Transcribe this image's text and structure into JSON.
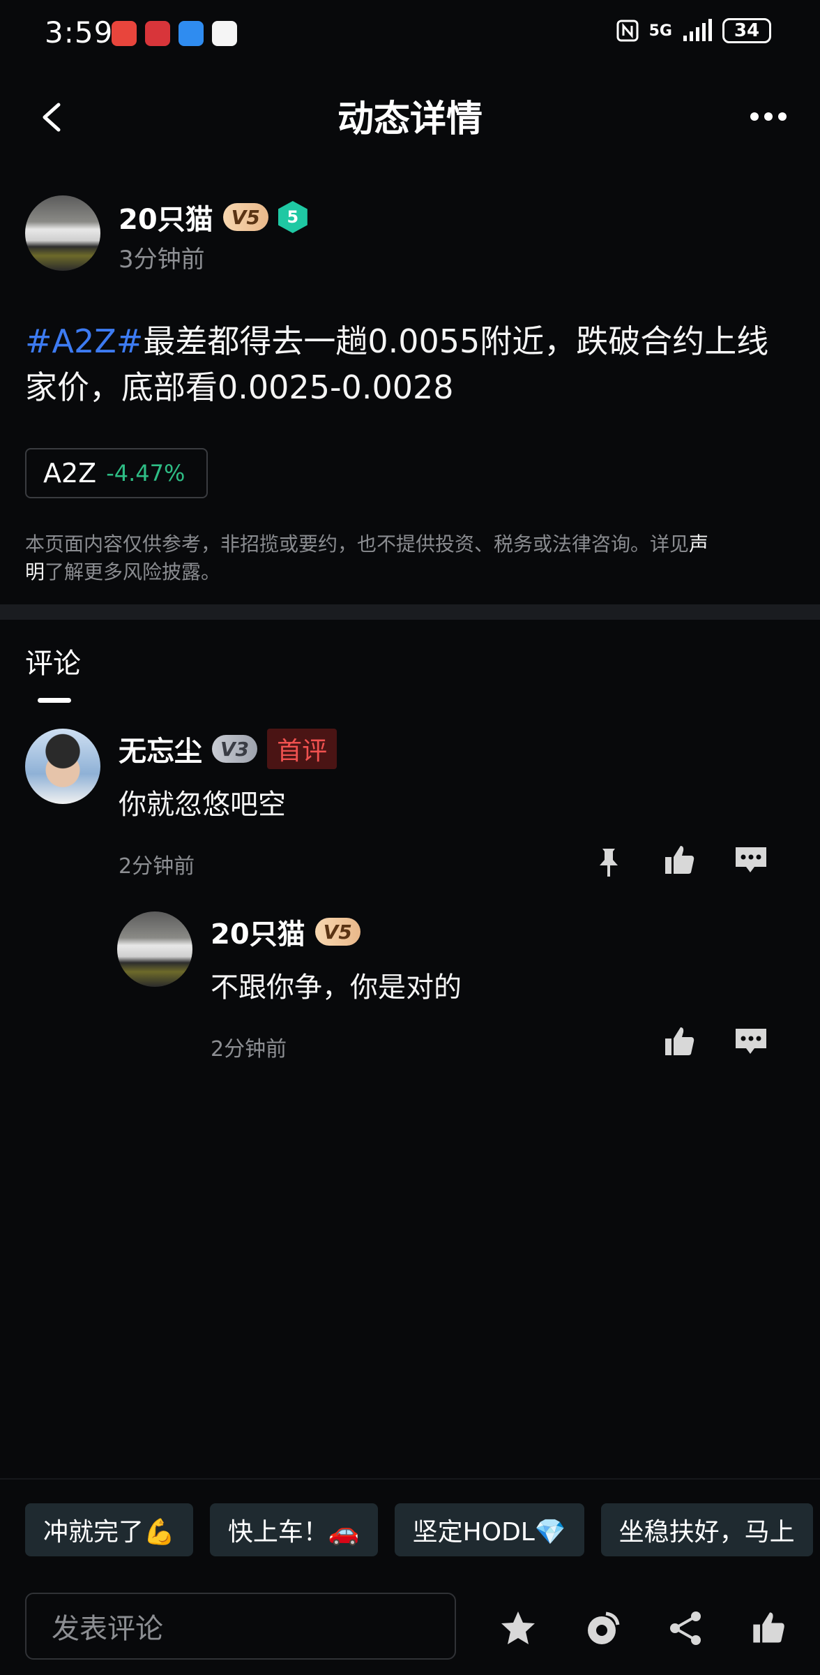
{
  "status_bar": {
    "time": "3:59",
    "network": "5G",
    "battery": "34"
  },
  "header": {
    "title": "动态详情"
  },
  "post": {
    "author": {
      "name": "20只猫",
      "vip_badge": "V5",
      "level": "5",
      "time": "3分钟前"
    },
    "hashtag": "#A2Z#",
    "text_line1": "最差都得去一趟0.0055附近，跌破合约上线",
    "text_line2": "家价，底部看0.0025-0.0028",
    "coin": {
      "name": "A2Z",
      "change": "-4.47%"
    },
    "disclaimer_text": "本页面内容仅供参考，非招揽或要约，也不提供投资、税务或法律咨询。详见",
    "disclaimer_link_1": "声",
    "disclaimer_link_2": "明",
    "disclaimer_tail": "了解更多风险披露。"
  },
  "comments_section": {
    "title": "评论",
    "comments": [
      {
        "name": "无忘尘",
        "vip_badge": "V3",
        "first_badge": "首评",
        "text": "你就忽悠吧空",
        "time": "2分钟前"
      }
    ],
    "reply": {
      "name": "20只猫",
      "vip_badge": "V5",
      "text": "不跟你争，你是对的",
      "time": "2分钟前"
    }
  },
  "quick_replies": [
    "冲就完了💪",
    "快上车！🚗",
    "坚定HODL💎",
    "坐稳扶好，马上"
  ],
  "footer": {
    "input_placeholder": "发表评论"
  },
  "colors": {
    "background": "#08090b",
    "hashtag": "#3d7bf2",
    "positive_change": "#2ebd85",
    "first_badge_text": "#f0514f"
  }
}
